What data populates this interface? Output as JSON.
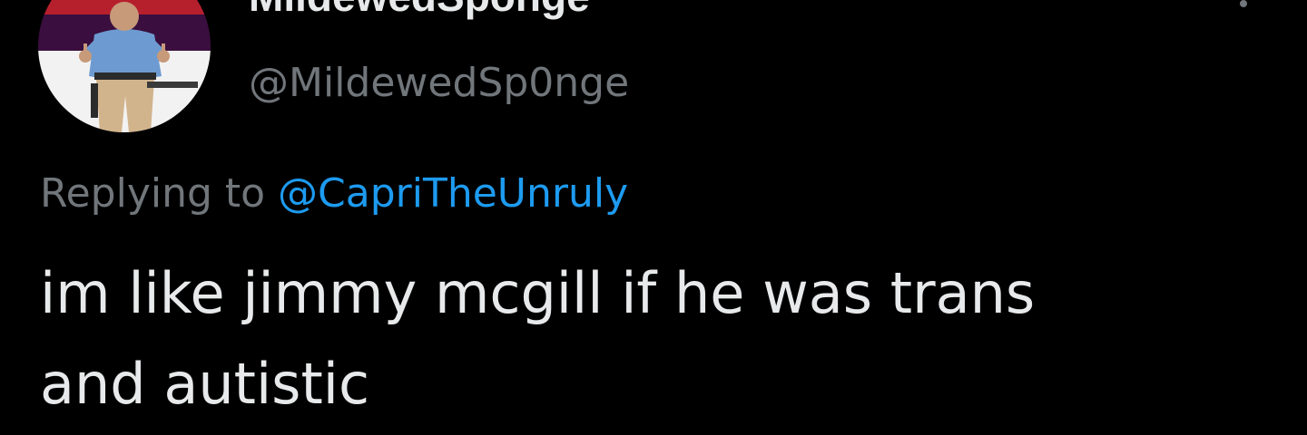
{
  "tweet": {
    "author": {
      "display_name": "MildewedSponge",
      "handle": "@MildewedSp0nge",
      "avatar_icon": "profile-photo-man-thumbs-up"
    },
    "more_menu_icon": "more-dots-vertical-icon",
    "replying_to": {
      "prefix": "Replying to ",
      "mention": "@CapriTheUnruly"
    },
    "text": {
      "line1": "im like jimmy mcgill if he was trans",
      "line2": "and autistic"
    }
  },
  "colors": {
    "background": "#000000",
    "primary_text": "#e7e9ea",
    "secondary_text": "#71767b",
    "link": "#1d9bf0"
  }
}
